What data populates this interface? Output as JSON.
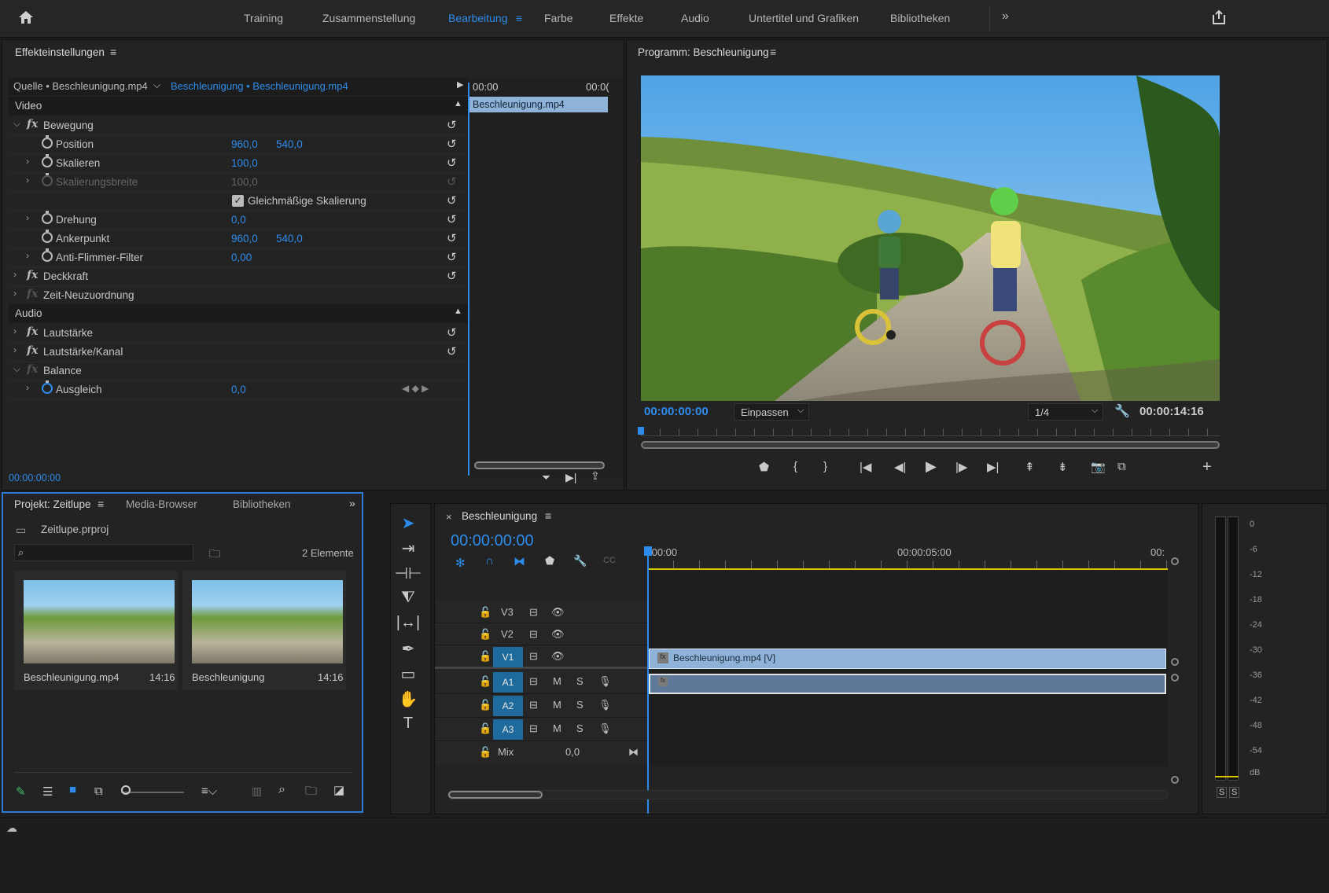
{
  "workspaces": {
    "items": [
      "Training",
      "Zusammenstellung",
      "Bearbeitung",
      "Farbe",
      "Effekte",
      "Audio",
      "Untertitel und Grafiken",
      "Bibliotheken"
    ],
    "active": "Bearbeitung",
    "more": "»"
  },
  "effect_controls": {
    "title": "Effekteinstellungen",
    "source_label": "Quelle • Beschleunigung.mp4",
    "sequence_label": "Beschleunigung • Beschleunigung.mp4",
    "section_video": "Video",
    "section_audio": "Audio",
    "mini_timeline": {
      "start": "00:00",
      "end": "00:0(",
      "clip": "Beschleunigung.mp4"
    },
    "current_time": "00:00:00:00",
    "rows": [
      {
        "label": "Bewegung"
      },
      {
        "label": "Position",
        "v1": "960,0",
        "v2": "540,0"
      },
      {
        "label": "Skalieren",
        "v1": "100,0"
      },
      {
        "label": "Skalierungsbreite",
        "v1": "100,0"
      },
      {
        "label": "Gleichmäßige Skalierung"
      },
      {
        "label": "Drehung",
        "v1": "0,0"
      },
      {
        "label": "Ankerpunkt",
        "v1": "960,0",
        "v2": "540,0"
      },
      {
        "label": "Anti-Flimmer-Filter",
        "v1": "0,00"
      },
      {
        "label": "Deckkraft"
      },
      {
        "label": "Zeit-Neuzuordnung"
      },
      {
        "label": "Lautstärke"
      },
      {
        "label": "Lautstärke/Kanal"
      },
      {
        "label": "Balance"
      },
      {
        "label": "Ausgleich",
        "v1": "0,0"
      }
    ]
  },
  "program": {
    "title": "Programm: Beschleunigung",
    "timecode": "00:00:00:00",
    "fit": "Einpassen",
    "quality": "1/4",
    "duration": "00:00:14:16"
  },
  "project": {
    "tabs": [
      "Projekt: Zeitlupe",
      "Media-Browser",
      "Bibliotheken"
    ],
    "file": "Zeitlupe.prproj",
    "count": "2 Elemente",
    "items": [
      {
        "name": "Beschleunigung.mp4",
        "duration": "14:16"
      },
      {
        "name": "Beschleunigung",
        "duration": "14:16"
      }
    ]
  },
  "timeline": {
    "title": "Beschleunigung",
    "timecode": "00:00:00:00",
    "ruler": [
      ":00:00",
      "00:00:05:00",
      "00:"
    ],
    "clip_label": "Beschleunigung.mp4 [V]",
    "video_tracks": [
      "V3",
      "V2",
      "V1"
    ],
    "audio_tracks": [
      "A1",
      "A2",
      "A3"
    ],
    "mix_label": "Mix",
    "mix_value": "0,0",
    "m": "M",
    "s": "S"
  },
  "meter": {
    "labels": [
      "0",
      "-6",
      "-12",
      "-18",
      "-24",
      "-30",
      "-36",
      "-42",
      "-48",
      "-54",
      "dB"
    ],
    "solo": [
      "S",
      "S"
    ]
  }
}
